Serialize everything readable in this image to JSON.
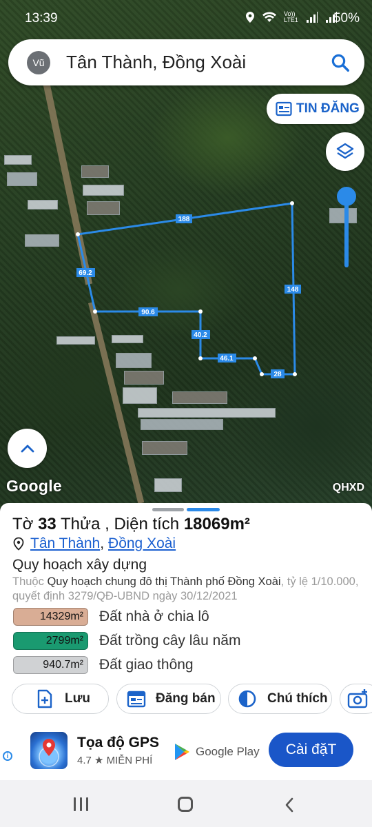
{
  "status_bar": {
    "time": "13:39",
    "network": "Vo)) LTE1",
    "battery": "50%"
  },
  "search": {
    "avatar_initials": "Vũ",
    "query": "Tân Thành, Đồng Xoài"
  },
  "map": {
    "tin_dang_label": "TIN ĐĂNG",
    "google_label": "Google",
    "layer_code": "QHXD",
    "plot_edges": [
      "188",
      "148",
      "69.2",
      "90.6",
      "40.2",
      "46.1",
      "28"
    ],
    "plot_color": "#2b8ae8"
  },
  "parcel": {
    "prefix_to": "Tờ",
    "to_number": "33",
    "thua_label": "Thửa",
    "area_label": ", Diện tích",
    "area_value": "18069m²",
    "ward": "Tân Thành",
    "city_sep": ",",
    "city": "Đồng Xoài"
  },
  "planning": {
    "heading": "Quy hoạch xây dựng",
    "desc_prefix": "Thuộc",
    "desc_plan": "Quy hoạch chung đô thị Thành phố Đồng Xoài",
    "desc_suffix": ", tỷ lệ 1/10.000, quyết định 3279/QĐ-UBND ngày 30/12/2021"
  },
  "land_use": [
    {
      "area": "14329m²",
      "label": "Đất nhà ở chia lô",
      "color": "#d9ad95"
    },
    {
      "area": "2799m²",
      "label": "Đất trồng cây lâu năm",
      "color": "#1a9a70"
    },
    {
      "area": "940.7m²",
      "label": "Đất giao thông",
      "color": "#d0d2d4"
    }
  ],
  "actions": {
    "save": "Lưu",
    "sell": "Đăng bán",
    "legend": "Chú thích"
  },
  "ad": {
    "info": "i",
    "title": "Tọa độ GPS",
    "rating": "4.7 ★  MIỄN PHÍ",
    "store": "Google Play",
    "install": "Cài đặT"
  }
}
